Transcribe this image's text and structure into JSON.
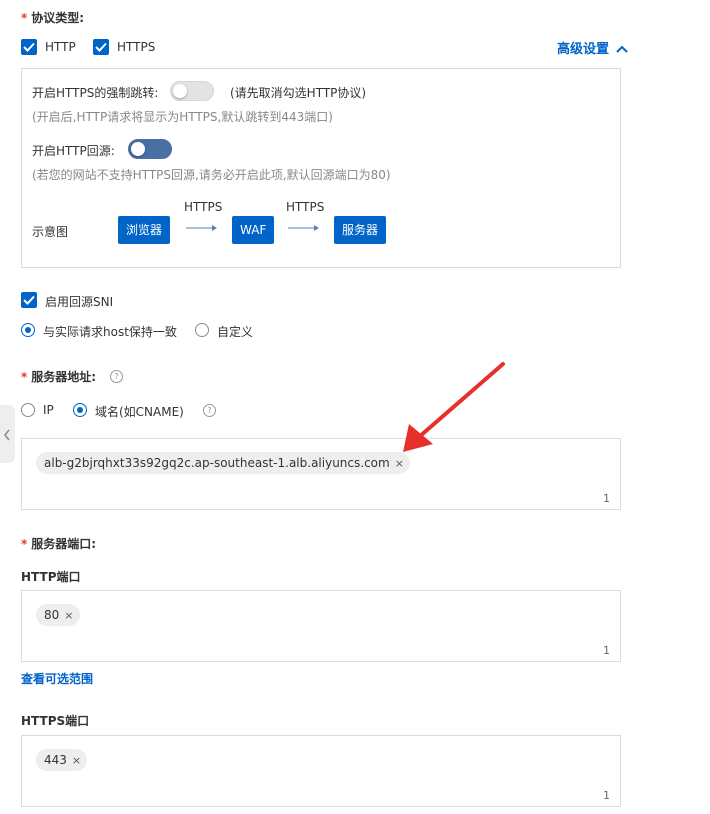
{
  "protocol": {
    "label": "协议类型:",
    "required_mark": "*",
    "http_label": "HTTP",
    "https_label": "HTTPS",
    "advanced_label": "高级设置",
    "force_redirect_label": "开启HTTPS的强制跳转:",
    "force_redirect_note": "(请先取消勾选HTTP协议)",
    "force_redirect_hint": "(开启后,HTTP请求将显示为HTTPS,默认跳转到443端口)",
    "http_origin_label": "开启HTTP回源:",
    "http_origin_hint": "(若您的网站不支持HTTPS回源,请务必开启此项,默认回源端口为80)",
    "diagram_label": "示意图",
    "flow": {
      "node1": "浏览器",
      "node2": "WAF",
      "node3": "服务器",
      "edge1": "HTTPS",
      "edge2": "HTTPS"
    }
  },
  "sni": {
    "enable_label": "启用回源SNI",
    "option_same_host": "与实际请求host保持一致",
    "option_custom": "自定义"
  },
  "server_address": {
    "label": "服务器地址:",
    "required_mark": "*",
    "option_ip": "IP",
    "option_domain": "域名(如CNAME)",
    "tag_value": "alb-g2bjrqhxt33s92gq2c.ap-southeast-1.alb.aliyuncs.com",
    "count": "1"
  },
  "server_port": {
    "label": "服务器端口:",
    "required_mark": "*",
    "http_port_label": "HTTP端口",
    "http_port_tag": "80",
    "http_port_count": "1",
    "view_range_link": "查看可选范围",
    "https_port_label": "HTTPS端口",
    "https_port_tag": "443",
    "https_port_count": "1"
  },
  "colors": {
    "primary": "#0064c8",
    "required": "#e23b2e",
    "annotation_arrow": "#e8302a"
  }
}
